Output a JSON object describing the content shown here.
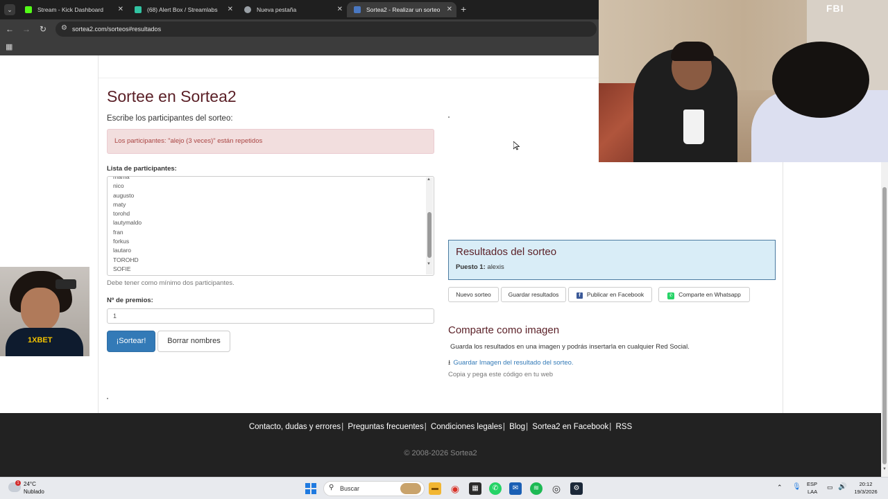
{
  "browser": {
    "tabs": [
      {
        "title": "Stream - Kick Dashboard",
        "favicon_color": "#53fc18"
      },
      {
        "title": "(68) Alert Box / Streamlabs",
        "favicon_color": "#31c3a2"
      },
      {
        "title": "Nueva pestaña",
        "favicon_color": "#9aa0a6"
      },
      {
        "title": "Sortea2 - Realizar un sorteo",
        "favicon_color": "#4a78c2"
      }
    ],
    "url": "sortea2.com/sorteos#resultados"
  },
  "page": {
    "title": "Sortee en Sortea2",
    "subtitle": "Escribe los participantes del sorteo:",
    "alert": "Los participantes: \"alejo (3 veces)\" están repetidos",
    "list_label": "Lista de participantes:",
    "participants": [
      "mama",
      "nico",
      "augusto",
      "maty",
      "torohd",
      "lautymaldo",
      "fran",
      "forkus",
      "lautaro",
      "TOROHD",
      "SOFIE"
    ],
    "help_text": "Debe tener como mínimo dos participantes.",
    "prizes_label": "Nº de premios:",
    "prizes_value": "1",
    "draw_button": "¡Sortear!",
    "clear_button": "Borrar nombres"
  },
  "results": {
    "heading": "Resultados del sorteo",
    "place_label": "Puesto 1:",
    "winner": "alexis",
    "buttons": {
      "new": "Nuevo sorteo",
      "save": "Guardar resultados",
      "facebook": "Publicar en Facebook",
      "whatsapp": "Comparte en Whatsapp"
    },
    "share_heading": "Comparte como imagen",
    "share_text": "Guarda los resultados en una imagen y podrás insertarla en cualquier Red Social.",
    "download_link": "Guardar Imagen del resultado del sorteo.",
    "copy_text": "Copia y pega este código en tu web"
  },
  "footer": {
    "links": [
      "Contacto, dudas y errores",
      "Preguntas frecuentes",
      "Condiciones legales",
      "Blog",
      "Sortea2 en Facebook",
      "RSS"
    ],
    "copyright": "© 2008-2026 Sortea2"
  },
  "webcam": {
    "overlay_label": "FBI",
    "shirt_logo": "1XBET"
  },
  "taskbar": {
    "temperature": "24°C",
    "condition": "Nublado",
    "search_placeholder": "Buscar",
    "lang1": "ESP",
    "lang2": "LAA",
    "time": "20:12",
    "date": "19/3/2026"
  }
}
